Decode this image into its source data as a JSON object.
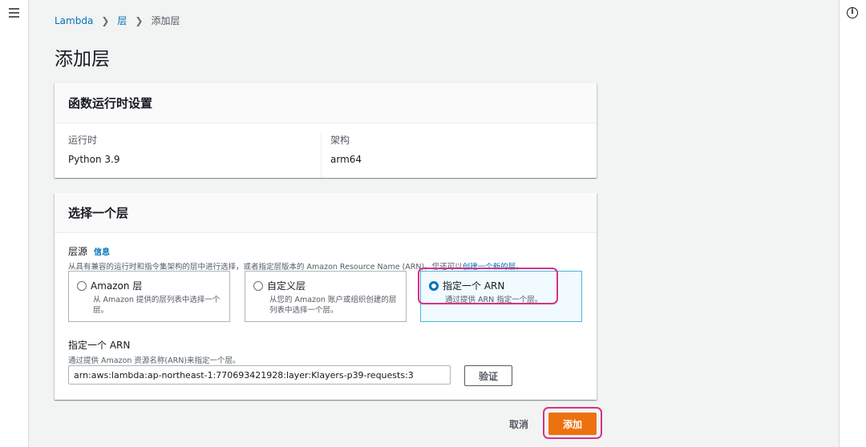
{
  "breadcrumb": {
    "items": [
      "Lambda",
      "层"
    ],
    "current": "添加层"
  },
  "page_title": "添加层",
  "runtime_settings": {
    "title": "函数运行时设置",
    "runtime_label": "运行时",
    "runtime_value": "Python 3.9",
    "arch_label": "架构",
    "arch_value": "arm64"
  },
  "choose_layer": {
    "title": "选择一个层",
    "source_label": "层源",
    "info_link": "信息",
    "source_desc": "从具有兼容的运行时和指令集架构的层中进行选择，或者指定层版本的 Amazon Resource Name (ARN)。您还可以",
    "source_desc_link": "创建一个新的层",
    "source_desc_end": "。",
    "options": [
      {
        "title": "Amazon 层",
        "desc": "从 Amazon 提供的层列表中选择一个层。",
        "selected": false
      },
      {
        "title": "自定义层",
        "desc": "从您的 Amazon 账户或组织创建的层列表中选择一个层。",
        "selected": false
      },
      {
        "title": "指定一个 ARN",
        "desc": "通过提供 ARN 指定一个层。",
        "selected": true
      }
    ],
    "arn_label": "指定一个 ARN",
    "arn_desc": "通过提供 Amazon 资源名称(ARN)来指定一个层。",
    "arn_value": "arn:aws:lambda:ap-northeast-1:770693421928:layer:Klayers-p39-requests:3",
    "verify_label": "验证"
  },
  "actions": {
    "cancel_label": "取消",
    "add_label": "添加"
  },
  "colors": {
    "link": "#0073bb",
    "primary": "#ec7211",
    "highlight": "#d63384",
    "selected_border": "#44b9d6"
  }
}
